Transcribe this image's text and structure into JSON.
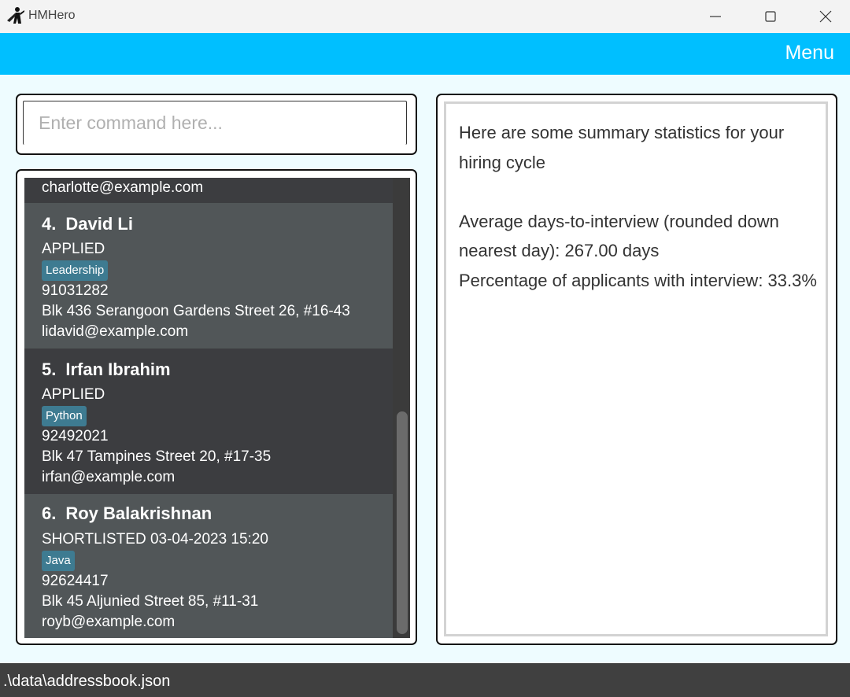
{
  "window": {
    "title": "HMHero",
    "icon": "hero-cape-icon",
    "controls": [
      "minimize-icon",
      "maximize-icon",
      "close-icon"
    ]
  },
  "menubar": {
    "label": "Menu",
    "color": "#00bfff"
  },
  "command": {
    "placeholder": "Enter command here...",
    "value": ""
  },
  "list": {
    "top_partial_email": "charlotte@example.com",
    "applicants": [
      {
        "index": "4.",
        "name": "David Li",
        "status": "APPLIED",
        "tag": "Leadership",
        "phone": "91031282",
        "address": "Blk 436 Serangoon Gardens Street 26, #16-43",
        "email": "lidavid@example.com"
      },
      {
        "index": "5.",
        "name": "Irfan Ibrahim",
        "status": "APPLIED",
        "tag": "Python",
        "phone": "92492021",
        "address": "Blk 47 Tampines Street 20, #17-35",
        "email": "irfan@example.com"
      },
      {
        "index": "6.",
        "name": "Roy Balakrishnan",
        "status": "SHORTLISTED 03-04-2023 15:20",
        "tag": "Java",
        "phone": "92624417",
        "address": "Blk 45 Aljunied Street 85, #11-31",
        "email": "royb@example.com"
      }
    ]
  },
  "stats": {
    "heading": "Here are some summary statistics for your hiring cycle",
    "average_days": "Average days-to-interview (rounded down nearest day): 267.00 days",
    "percentage": "Percentage of applicants with interview: 33.3%"
  },
  "statusbar": {
    "path": ".\\data\\addressbook.json"
  },
  "colors": {
    "accent": "#00bfff",
    "tag_bg": "#3e7b91",
    "card_light": "#515658",
    "card_dark": "#3c3d40",
    "background": "#eefcff"
  }
}
